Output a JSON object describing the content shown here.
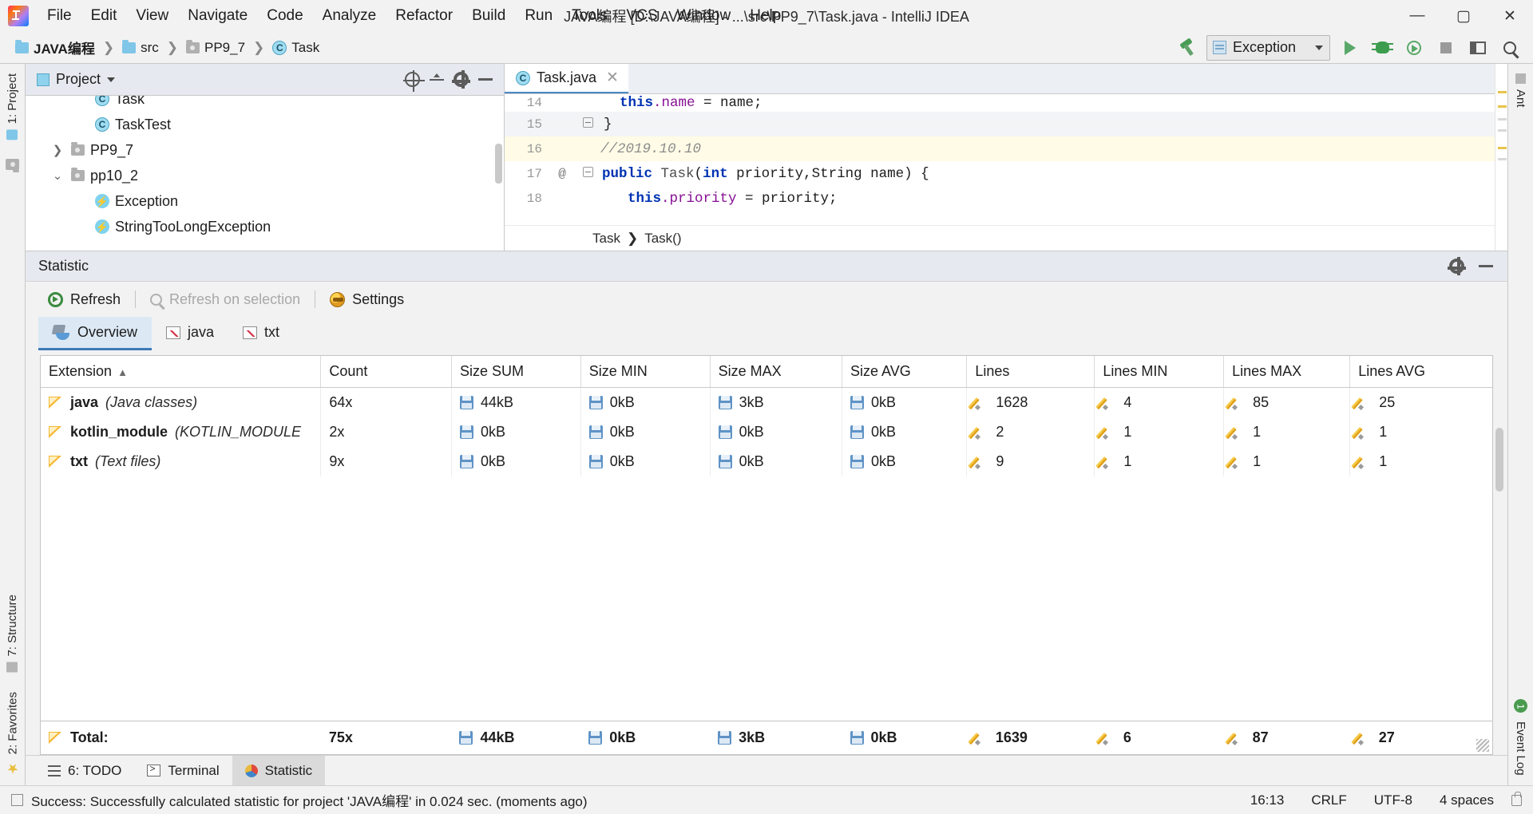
{
  "window": {
    "title": "JAVA编程 [D:\\JAVA编程] - ...\\src\\PP9_7\\Task.java - IntelliJ IDEA",
    "minimize_label": "—",
    "maximize_label": "▢",
    "close_label": "✕",
    "logo_icon": "intellij-idea-logo"
  },
  "menu": {
    "items": [
      {
        "label": "File"
      },
      {
        "label": "Edit"
      },
      {
        "label": "View"
      },
      {
        "label": "Navigate"
      },
      {
        "label": "Code"
      },
      {
        "label": "Analyze"
      },
      {
        "label": "Refactor"
      },
      {
        "label": "Build"
      },
      {
        "label": "Run"
      },
      {
        "label": "Tools"
      },
      {
        "label": "VCS"
      },
      {
        "label": "Window"
      },
      {
        "label": "Help"
      }
    ]
  },
  "navbar": {
    "crumbs": [
      {
        "label": "JAVA编程",
        "icon": "folder-icon"
      },
      {
        "label": "src",
        "icon": "folder-icon"
      },
      {
        "label": "PP9_7",
        "icon": "folder-grey-icon"
      },
      {
        "label": "Task",
        "icon": "class-icon",
        "badge": "C"
      }
    ],
    "separator": "❯",
    "build_icon": "hammer-icon",
    "run_config": {
      "name": "Exception",
      "icon": "run-config-icon",
      "dropdown_icon": "chevron-down-icon"
    },
    "actions": [
      {
        "name": "run-button",
        "icon": "play-icon"
      },
      {
        "name": "debug-button",
        "icon": "bug-icon"
      },
      {
        "name": "run-with-coverage-button",
        "icon": "coverage-icon"
      },
      {
        "name": "stop-button",
        "icon": "stop-icon"
      },
      {
        "name": "layout-button",
        "icon": "layout-icon"
      },
      {
        "name": "search-everywhere-button",
        "icon": "search-icon"
      }
    ]
  },
  "left_rail": {
    "items": [
      {
        "label": "1: Project",
        "icon": "project-icon"
      },
      {
        "label": "",
        "icon": "folder-small-icon"
      }
    ],
    "bottom_items": [
      {
        "label": "7: Structure",
        "icon": "structure-icon"
      },
      {
        "label": "2: Favorites",
        "icon": "favorites-star-icon"
      }
    ]
  },
  "right_rail": {
    "items": [
      {
        "label": "Ant",
        "icon": "ant-icon"
      },
      {
        "label": "Event Log",
        "icon": "event-log-icon",
        "badge": "1"
      }
    ]
  },
  "project_panel": {
    "title": "Project",
    "dropdown_icon": "chevron-down-icon",
    "actions": [
      {
        "name": "select-opened-file-button",
        "icon": "target-icon"
      },
      {
        "name": "collapse-all-button",
        "icon": "collapse-all-icon"
      },
      {
        "name": "settings-button",
        "icon": "gear-icon"
      },
      {
        "name": "hide-button",
        "icon": "minimize-icon"
      }
    ],
    "tree": [
      {
        "label": "Task",
        "icon": "class-icon",
        "badge": "C",
        "indent": 3,
        "toggle": "",
        "partial": true
      },
      {
        "label": "TaskTest",
        "icon": "class-icon",
        "badge": "C",
        "indent": 3,
        "toggle": ""
      },
      {
        "label": "PP9_7",
        "icon": "folder-grey-icon",
        "indent": 2,
        "toggle": "❯"
      },
      {
        "label": "pp10_2",
        "icon": "folder-grey-icon",
        "indent": 2,
        "toggle": "⌄"
      },
      {
        "label": "Exception",
        "icon": "exception-class-icon",
        "indent": 3,
        "toggle": ""
      },
      {
        "label": "StringTooLongException",
        "icon": "exception-class-icon",
        "indent": 3,
        "toggle": ""
      }
    ]
  },
  "editor": {
    "tab": {
      "label": "Task.java",
      "icon": "class-icon",
      "badge": "C",
      "close_icon": "close-icon"
    },
    "lines": [
      {
        "num": "14",
        "text": "this.name = name;",
        "state": "clipped"
      },
      {
        "num": "15",
        "text": "}",
        "state": "current"
      },
      {
        "num": "16",
        "text": "//2019.10.10",
        "state": "highlight"
      },
      {
        "num": "17",
        "text": "public Task(int priority,String name) {",
        "state": "normal",
        "gutter": "@"
      },
      {
        "num": "18",
        "text": "this.priority = priority;",
        "state": "normal"
      }
    ],
    "breadcrumb": [
      "Task",
      "Task()"
    ],
    "breadcrumb_separator": "❯"
  },
  "statistic": {
    "title": "Statistic",
    "header_actions": [
      {
        "name": "settings-button",
        "icon": "gear-icon"
      },
      {
        "name": "hide-button",
        "icon": "minimize-icon"
      }
    ],
    "toolbar": [
      {
        "label": "Refresh",
        "icon": "refresh-icon",
        "enabled": true
      },
      {
        "label": "Refresh on selection",
        "icon": "magnifier-icon",
        "enabled": false
      },
      {
        "label": "Settings",
        "icon": "settings-icon",
        "enabled": true
      }
    ],
    "tabs": [
      {
        "label": "Overview",
        "icon": "overview-icon",
        "active": true
      },
      {
        "label": "java",
        "icon": "chart-icon",
        "active": false
      },
      {
        "label": "txt",
        "icon": "chart-icon",
        "active": false
      }
    ],
    "table": {
      "columns": [
        {
          "label": "Extension",
          "sort": "▲",
          "width": "19.3%"
        },
        {
          "label": "Count",
          "sort": "",
          "width": "9.0%"
        },
        {
          "label": "Size SUM",
          "sort": "",
          "width": "8.9%"
        },
        {
          "label": "Size MIN",
          "sort": "",
          "width": "8.9%"
        },
        {
          "label": "Size MAX",
          "sort": "",
          "width": "9.1%"
        },
        {
          "label": "Size AVG",
          "sort": "",
          "width": "8.6%"
        },
        {
          "label": "Lines",
          "sort": "",
          "width": "8.8%"
        },
        {
          "label": "Lines MIN",
          "sort": "",
          "width": "8.9%"
        },
        {
          "label": "Lines MAX",
          "sort": "",
          "width": "8.7%"
        },
        {
          "label": "Lines AVG",
          "sort": "",
          "width": "9.8%"
        }
      ],
      "rows": [
        {
          "ext_name": "java",
          "ext_desc": "(Java classes)",
          "count": "64x",
          "size_sum": "44kB",
          "size_min": "0kB",
          "size_max": "3kB",
          "size_avg": "0kB",
          "lines": "1628",
          "lines_min": "4",
          "lines_max": "85",
          "lines_avg": "25"
        },
        {
          "ext_name": "kotlin_module",
          "ext_desc": "(KOTLIN_MODULE",
          "count": "2x",
          "size_sum": "0kB",
          "size_min": "0kB",
          "size_max": "0kB",
          "size_avg": "0kB",
          "lines": "2",
          "lines_min": "1",
          "lines_max": "1",
          "lines_avg": "1"
        },
        {
          "ext_name": "txt",
          "ext_desc": "(Text files)",
          "count": "9x",
          "size_sum": "0kB",
          "size_min": "0kB",
          "size_max": "0kB",
          "size_avg": "0kB",
          "lines": "9",
          "lines_min": "1",
          "lines_max": "1",
          "lines_avg": "1"
        }
      ],
      "total": {
        "label": "Total:",
        "count": "75x",
        "size_sum": "44kB",
        "size_min": "0kB",
        "size_max": "3kB",
        "size_avg": "0kB",
        "lines": "1639",
        "lines_min": "6",
        "lines_max": "87",
        "lines_avg": "27"
      }
    }
  },
  "bottom_tabs": [
    {
      "label": "6: TODO",
      "icon": "todo-icon",
      "active": false
    },
    {
      "label": "Terminal",
      "icon": "terminal-icon",
      "active": false
    },
    {
      "label": "Statistic",
      "icon": "statistic-icon",
      "active": true
    }
  ],
  "statusbar": {
    "message": "Success: Successfully calculated statistic for project 'JAVA编程' in 0.024 sec. (moments ago)",
    "position": "16:13",
    "line_separator": "CRLF",
    "encoding": "UTF-8",
    "indent": "4 spaces",
    "lock_icon": "lock-icon",
    "left_icon": "status-left-icon"
  }
}
